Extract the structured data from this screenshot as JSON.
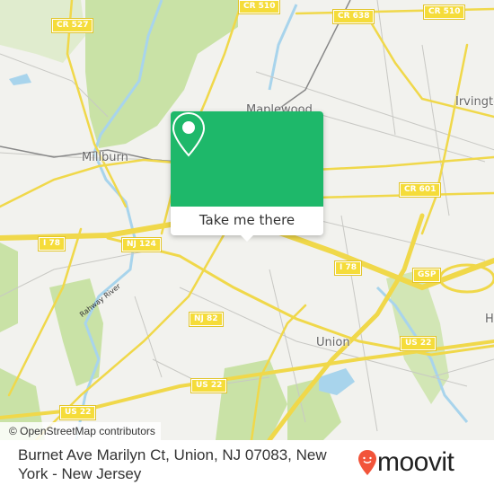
{
  "map": {
    "places": [
      {
        "name": "Millburn",
        "key": "millburn"
      },
      {
        "name": "Maplewood",
        "key": "maplewood"
      },
      {
        "name": "Irvington",
        "key": "irvington"
      },
      {
        "name": "Union",
        "key": "union"
      },
      {
        "name": "H",
        "key": "hillside-partial"
      }
    ],
    "road_shields": [
      {
        "label": "CR 527"
      },
      {
        "label": "CR 510"
      },
      {
        "label": "CR 638"
      },
      {
        "label": "CR 510"
      },
      {
        "label": "CR 601"
      },
      {
        "label": "I 78"
      },
      {
        "label": "NJ 124"
      },
      {
        "label": "I 78"
      },
      {
        "label": "GSP"
      },
      {
        "label": "NJ 82"
      },
      {
        "label": "US 22"
      },
      {
        "label": "US 22"
      },
      {
        "label": "US 22"
      }
    ],
    "river_label": "Rahway River",
    "attribution": "© OpenStreetMap contributors"
  },
  "popup": {
    "icon": "map-pin-icon",
    "cta_label": "Take me there",
    "color": "#1eb86a"
  },
  "footer": {
    "address": "Burnet Ave Marilyn Ct, Union, NJ 07083, New York - New Jersey",
    "brand": "moovit",
    "brand_color": "#f2543a"
  }
}
